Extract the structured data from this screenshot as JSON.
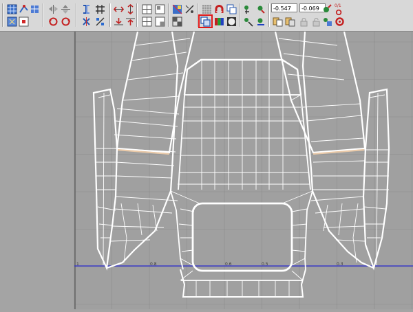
{
  "toolbar": {
    "coord_u": "-0.547",
    "coord_v": "-0.069",
    "scale_label": "0/1",
    "selected_tool": "copy-overlap-icon",
    "buttons": [
      {
        "name": "uv-grid-icon"
      },
      {
        "name": "move-icon"
      },
      {
        "name": "relax-icon"
      },
      {
        "name": "filter-icon"
      },
      {
        "name": "add-map-icon"
      },
      {
        "name": "mirror-h-icon"
      },
      {
        "name": "mirror-v-icon"
      },
      {
        "name": "rotate-ccw-icon"
      },
      {
        "name": "rotate-cw-icon"
      },
      {
        "name": "stitch-icon"
      },
      {
        "name": "weld-grid-icon"
      },
      {
        "name": "stitch-cross-icon"
      },
      {
        "name": "break-icon"
      },
      {
        "name": "align-h-icon"
      },
      {
        "name": "align-v-icon"
      },
      {
        "name": "align-left-icon"
      },
      {
        "name": "align-right-icon"
      },
      {
        "name": "pack-icon"
      },
      {
        "name": "pack-cluster-icon"
      },
      {
        "name": "select-edge-icon"
      },
      {
        "name": "select-face-icon"
      },
      {
        "name": "texture-icon"
      },
      {
        "name": "show-map-icon"
      },
      {
        "name": "checker-grid-icon"
      },
      {
        "name": "snap-icon"
      },
      {
        "name": "magnet-icon"
      },
      {
        "name": "copy-icon"
      },
      {
        "name": "copy-overlap-icon"
      },
      {
        "name": "color-channel-icon"
      },
      {
        "name": "sphere-icon"
      },
      {
        "name": "pick-icon"
      },
      {
        "name": "unfold-icon"
      },
      {
        "name": "normalize-icon"
      },
      {
        "name": "flatten-icon"
      },
      {
        "name": "paste-icon"
      },
      {
        "name": "paste-weld-icon"
      },
      {
        "name": "lock-icon"
      },
      {
        "name": "unlock-icon"
      },
      {
        "name": "scale-icon"
      },
      {
        "name": "scale-reset-icon"
      }
    ]
  },
  "viewport": {
    "grid_color": "#8c8c8c",
    "wire_color": "#ffffff",
    "edge_highlight": "#e9c9a8",
    "axis_color": "#2a2ad0",
    "axis_labels": [
      "1",
      "0.8",
      "0.6",
      "0.5",
      "0.3"
    ]
  }
}
